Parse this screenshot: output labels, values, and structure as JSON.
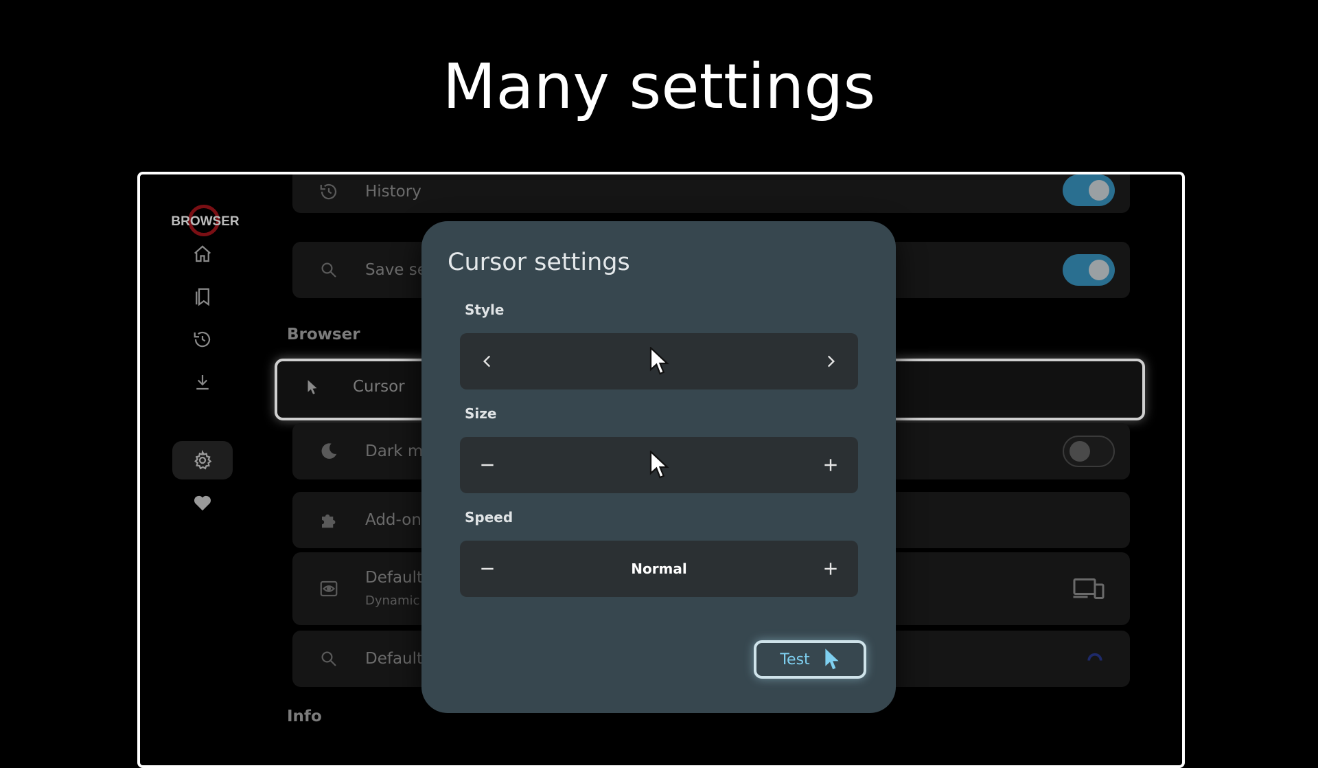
{
  "headline": "Many settings",
  "app": {
    "logo_text": "BROWSER"
  },
  "sidebar": {
    "items": [
      {
        "name": "home-icon"
      },
      {
        "name": "bookmarks-icon"
      },
      {
        "name": "history-icon"
      },
      {
        "name": "downloads-icon"
      },
      {
        "name": "settings-icon",
        "active": true
      },
      {
        "name": "heart-icon"
      }
    ]
  },
  "settings": {
    "rows": [
      {
        "label": "History",
        "icon": "history-icon",
        "toggle": "on"
      },
      {
        "label": "Save se",
        "icon": "search-history-icon",
        "toggle": "on"
      }
    ],
    "browser_section": "Browser",
    "browser_rows": [
      {
        "label": "Cursor",
        "icon": "cursor-icon"
      },
      {
        "label": "Dark m",
        "icon": "moon-icon",
        "toggle": "off"
      },
      {
        "label": "Add-on",
        "icon": "puzzle-icon"
      },
      {
        "label": "Default",
        "sub": "Dynamic",
        "icon": "eye-window-icon"
      },
      {
        "label": "Default",
        "icon": "search-icon"
      }
    ],
    "info_section": "Info"
  },
  "dialog": {
    "title": "Cursor settings",
    "style_label": "Style",
    "size_label": "Size",
    "speed_label": "Speed",
    "speed_value": "Normal",
    "test_label": "Test"
  },
  "colors": {
    "dialog_bg": "#37474f",
    "toggle_on": "#2a6f90",
    "test_accent": "#7fd0f0"
  }
}
